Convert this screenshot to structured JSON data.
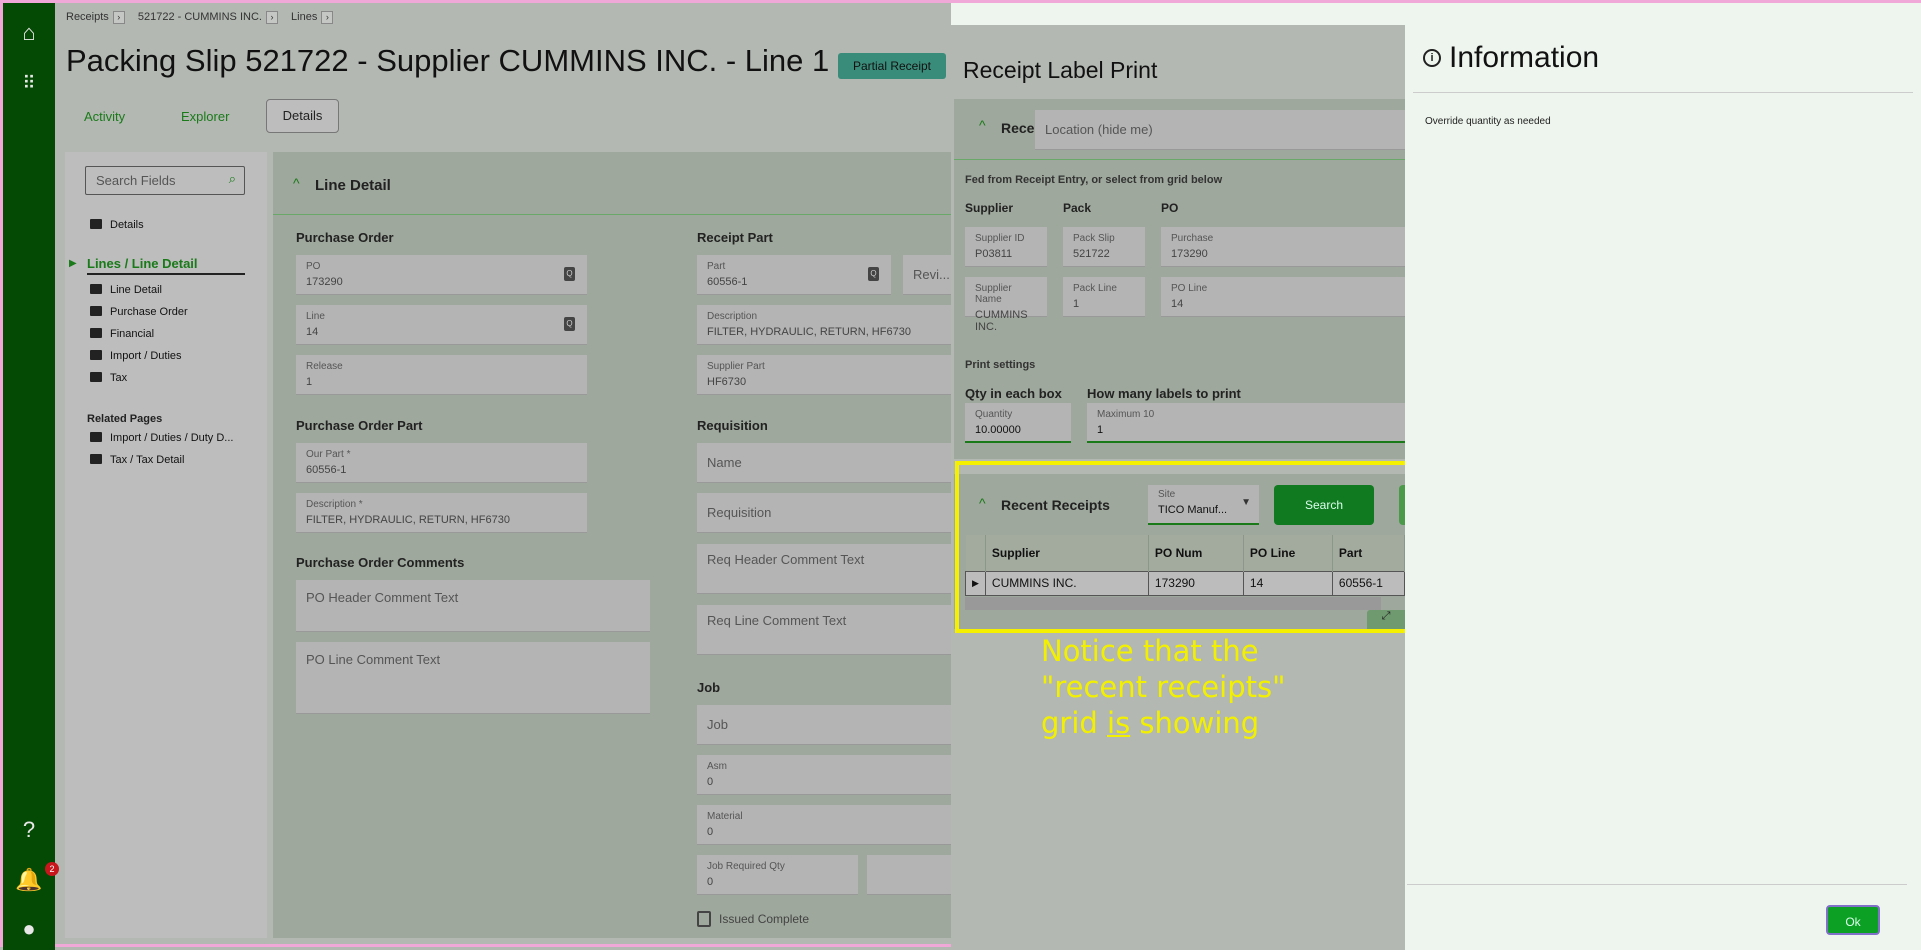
{
  "rail": {
    "notification_count": "2"
  },
  "breadcrumb": [
    "Receipts",
    "521722 - CUMMINS INC.",
    "Lines"
  ],
  "header": {
    "title": "Packing Slip 521722 - Supplier CUMMINS INC. - Line 1",
    "status_badge": "Partial Receipt"
  },
  "tabs": [
    "Activity",
    "Explorer",
    "Details"
  ],
  "nav": {
    "search_placeholder": "Search Fields",
    "details": "Details",
    "active": "Lines / Line Detail",
    "items": [
      "Line Detail",
      "Purchase Order",
      "Financial",
      "Import / Duties",
      "Tax"
    ],
    "related_title": "Related Pages",
    "related": [
      "Import / Duties / Duty D...",
      "Tax / Tax Detail"
    ]
  },
  "line_detail": {
    "title": "Line Detail",
    "purchase_order": {
      "title": "Purchase Order",
      "po_label": "PO",
      "po": "173290",
      "line_label": "Line",
      "line": "14",
      "release_label": "Release",
      "release": "1"
    },
    "po_part": {
      "title": "Purchase Order Part",
      "our_part_label": "Our Part *",
      "our_part": "60556-1",
      "desc_label": "Description *",
      "desc": "FILTER, HYDRAULIC, RETURN, HF6730"
    },
    "po_comments": {
      "title": "Purchase Order Comments",
      "header_ph": "PO Header Comment Text",
      "line_ph": "PO Line Comment Text"
    },
    "receipt_part": {
      "title": "Receipt Part",
      "part_label": "Part",
      "part": "60556-1",
      "rev": "Revi...",
      "desc_label": "Description",
      "desc": "FILTER, HYDRAULIC, RETURN, HF6730",
      "supplier_part_label": "Supplier Part",
      "supplier_part": "HF6730"
    },
    "requisition": {
      "title": "Requisition",
      "name_ph": "Name",
      "req_ph": "Requisition",
      "req_header_ph": "Req Header Comment Text",
      "req_line_ph": "Req Line Comment Text"
    },
    "job": {
      "title": "Job",
      "job_ph": "Job",
      "asm_label": "Asm",
      "asm": "0",
      "material_label": "Material",
      "material": "0",
      "req_qty_label": "Job Required Qty",
      "req_qty": "0",
      "issued_complete": "Issued Complete"
    }
  },
  "label_print": {
    "title": "Receipt Label Print",
    "receipt_info": "Receipt info",
    "location_ph": "Location (hide me)",
    "fed_note": "Fed from Receipt Entry, or select from grid below",
    "supplier": {
      "title": "Supplier",
      "id_label": "Supplier ID",
      "id": "P03811",
      "name_label": "Supplier Name",
      "name": "CUMMINS INC."
    },
    "pack": {
      "title": "Pack",
      "slip_label": "Pack Slip",
      "slip": "521722",
      "line_label": "Pack Line",
      "line": "1"
    },
    "po": {
      "title": "PO",
      "po_label": "Purchase",
      "po": "173290",
      "line_label": "PO Line",
      "line": "14"
    },
    "print_settings": "Print settings",
    "qty_title": "Qty in each box",
    "qty_label": "Quantity",
    "qty": "10.00000",
    "labels_title": "How many labels to print",
    "labels_label": "Maximum 10",
    "labels": "1",
    "recent": {
      "title": "Recent Receipts",
      "site_label": "Site",
      "site": "TICO Manuf...",
      "search": "Search",
      "columns": [
        "Supplier",
        "PO Num",
        "PO Line",
        "Part"
      ],
      "rows": [
        [
          "CUMMINS INC.",
          "173290",
          "14",
          "60556-1"
        ]
      ]
    }
  },
  "annotation": {
    "line1": "Notice that the",
    "line2": "\"recent receipts\"",
    "line3_a": "grid ",
    "line3_u": "is",
    "line3_b": " showing"
  },
  "info_panel": {
    "title": "Information",
    "message": "Override quantity as needed",
    "ok": "Ok"
  }
}
